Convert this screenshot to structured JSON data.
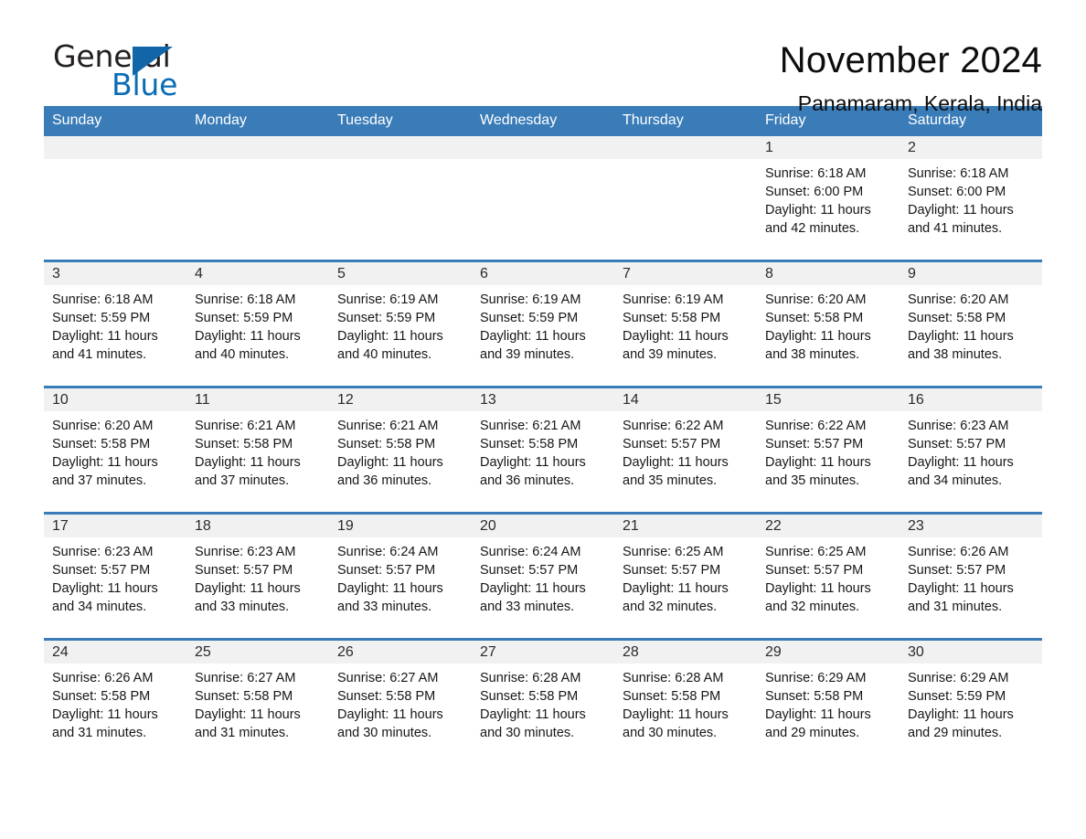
{
  "logo": {
    "word_one": "General",
    "word_two": "Blue",
    "triangle_color": "#1266a8",
    "text_color": "#231f20",
    "blue_text_color": "#0b6cb5"
  },
  "header": {
    "title": "November 2024",
    "subtitle": "Panamaram, Kerala, India"
  },
  "theme": {
    "header_blue": "#3a7cb8",
    "row_rule_blue": "#3a7cb8",
    "date_band_gray": "#f1f1f1",
    "page_background": "#ffffff"
  },
  "weekdays": [
    "Sunday",
    "Monday",
    "Tuesday",
    "Wednesday",
    "Thursday",
    "Friday",
    "Saturday"
  ],
  "labels": {
    "sunrise_prefix": "Sunrise:",
    "sunset_prefix": "Sunset:",
    "daylight_prefix": "Daylight:"
  },
  "weeks": [
    {
      "days": [
        {
          "date": "",
          "sunrise": "",
          "sunset": "",
          "daylight": ""
        },
        {
          "date": "",
          "sunrise": "",
          "sunset": "",
          "daylight": ""
        },
        {
          "date": "",
          "sunrise": "",
          "sunset": "",
          "daylight": ""
        },
        {
          "date": "",
          "sunrise": "",
          "sunset": "",
          "daylight": ""
        },
        {
          "date": "",
          "sunrise": "",
          "sunset": "",
          "daylight": ""
        },
        {
          "date": "1",
          "sunrise": "Sunrise: 6:18 AM",
          "sunset": "Sunset: 6:00 PM",
          "daylight": "Daylight: 11 hours and 42 minutes."
        },
        {
          "date": "2",
          "sunrise": "Sunrise: 6:18 AM",
          "sunset": "Sunset: 6:00 PM",
          "daylight": "Daylight: 11 hours and 41 minutes."
        }
      ]
    },
    {
      "days": [
        {
          "date": "3",
          "sunrise": "Sunrise: 6:18 AM",
          "sunset": "Sunset: 5:59 PM",
          "daylight": "Daylight: 11 hours and 41 minutes."
        },
        {
          "date": "4",
          "sunrise": "Sunrise: 6:18 AM",
          "sunset": "Sunset: 5:59 PM",
          "daylight": "Daylight: 11 hours and 40 minutes."
        },
        {
          "date": "5",
          "sunrise": "Sunrise: 6:19 AM",
          "sunset": "Sunset: 5:59 PM",
          "daylight": "Daylight: 11 hours and 40 minutes."
        },
        {
          "date": "6",
          "sunrise": "Sunrise: 6:19 AM",
          "sunset": "Sunset: 5:59 PM",
          "daylight": "Daylight: 11 hours and 39 minutes."
        },
        {
          "date": "7",
          "sunrise": "Sunrise: 6:19 AM",
          "sunset": "Sunset: 5:58 PM",
          "daylight": "Daylight: 11 hours and 39 minutes."
        },
        {
          "date": "8",
          "sunrise": "Sunrise: 6:20 AM",
          "sunset": "Sunset: 5:58 PM",
          "daylight": "Daylight: 11 hours and 38 minutes."
        },
        {
          "date": "9",
          "sunrise": "Sunrise: 6:20 AM",
          "sunset": "Sunset: 5:58 PM",
          "daylight": "Daylight: 11 hours and 38 minutes."
        }
      ]
    },
    {
      "days": [
        {
          "date": "10",
          "sunrise": "Sunrise: 6:20 AM",
          "sunset": "Sunset: 5:58 PM",
          "daylight": "Daylight: 11 hours and 37 minutes."
        },
        {
          "date": "11",
          "sunrise": "Sunrise: 6:21 AM",
          "sunset": "Sunset: 5:58 PM",
          "daylight": "Daylight: 11 hours and 37 minutes."
        },
        {
          "date": "12",
          "sunrise": "Sunrise: 6:21 AM",
          "sunset": "Sunset: 5:58 PM",
          "daylight": "Daylight: 11 hours and 36 minutes."
        },
        {
          "date": "13",
          "sunrise": "Sunrise: 6:21 AM",
          "sunset": "Sunset: 5:58 PM",
          "daylight": "Daylight: 11 hours and 36 minutes."
        },
        {
          "date": "14",
          "sunrise": "Sunrise: 6:22 AM",
          "sunset": "Sunset: 5:57 PM",
          "daylight": "Daylight: 11 hours and 35 minutes."
        },
        {
          "date": "15",
          "sunrise": "Sunrise: 6:22 AM",
          "sunset": "Sunset: 5:57 PM",
          "daylight": "Daylight: 11 hours and 35 minutes."
        },
        {
          "date": "16",
          "sunrise": "Sunrise: 6:23 AM",
          "sunset": "Sunset: 5:57 PM",
          "daylight": "Daylight: 11 hours and 34 minutes."
        }
      ]
    },
    {
      "days": [
        {
          "date": "17",
          "sunrise": "Sunrise: 6:23 AM",
          "sunset": "Sunset: 5:57 PM",
          "daylight": "Daylight: 11 hours and 34 minutes."
        },
        {
          "date": "18",
          "sunrise": "Sunrise: 6:23 AM",
          "sunset": "Sunset: 5:57 PM",
          "daylight": "Daylight: 11 hours and 33 minutes."
        },
        {
          "date": "19",
          "sunrise": "Sunrise: 6:24 AM",
          "sunset": "Sunset: 5:57 PM",
          "daylight": "Daylight: 11 hours and 33 minutes."
        },
        {
          "date": "20",
          "sunrise": "Sunrise: 6:24 AM",
          "sunset": "Sunset: 5:57 PM",
          "daylight": "Daylight: 11 hours and 33 minutes."
        },
        {
          "date": "21",
          "sunrise": "Sunrise: 6:25 AM",
          "sunset": "Sunset: 5:57 PM",
          "daylight": "Daylight: 11 hours and 32 minutes."
        },
        {
          "date": "22",
          "sunrise": "Sunrise: 6:25 AM",
          "sunset": "Sunset: 5:57 PM",
          "daylight": "Daylight: 11 hours and 32 minutes."
        },
        {
          "date": "23",
          "sunrise": "Sunrise: 6:26 AM",
          "sunset": "Sunset: 5:57 PM",
          "daylight": "Daylight: 11 hours and 31 minutes."
        }
      ]
    },
    {
      "days": [
        {
          "date": "24",
          "sunrise": "Sunrise: 6:26 AM",
          "sunset": "Sunset: 5:58 PM",
          "daylight": "Daylight: 11 hours and 31 minutes."
        },
        {
          "date": "25",
          "sunrise": "Sunrise: 6:27 AM",
          "sunset": "Sunset: 5:58 PM",
          "daylight": "Daylight: 11 hours and 31 minutes."
        },
        {
          "date": "26",
          "sunrise": "Sunrise: 6:27 AM",
          "sunset": "Sunset: 5:58 PM",
          "daylight": "Daylight: 11 hours and 30 minutes."
        },
        {
          "date": "27",
          "sunrise": "Sunrise: 6:28 AM",
          "sunset": "Sunset: 5:58 PM",
          "daylight": "Daylight: 11 hours and 30 minutes."
        },
        {
          "date": "28",
          "sunrise": "Sunrise: 6:28 AM",
          "sunset": "Sunset: 5:58 PM",
          "daylight": "Daylight: 11 hours and 30 minutes."
        },
        {
          "date": "29",
          "sunrise": "Sunrise: 6:29 AM",
          "sunset": "Sunset: 5:58 PM",
          "daylight": "Daylight: 11 hours and 29 minutes."
        },
        {
          "date": "30",
          "sunrise": "Sunrise: 6:29 AM",
          "sunset": "Sunset: 5:59 PM",
          "daylight": "Daylight: 11 hours and 29 minutes."
        }
      ]
    }
  ]
}
